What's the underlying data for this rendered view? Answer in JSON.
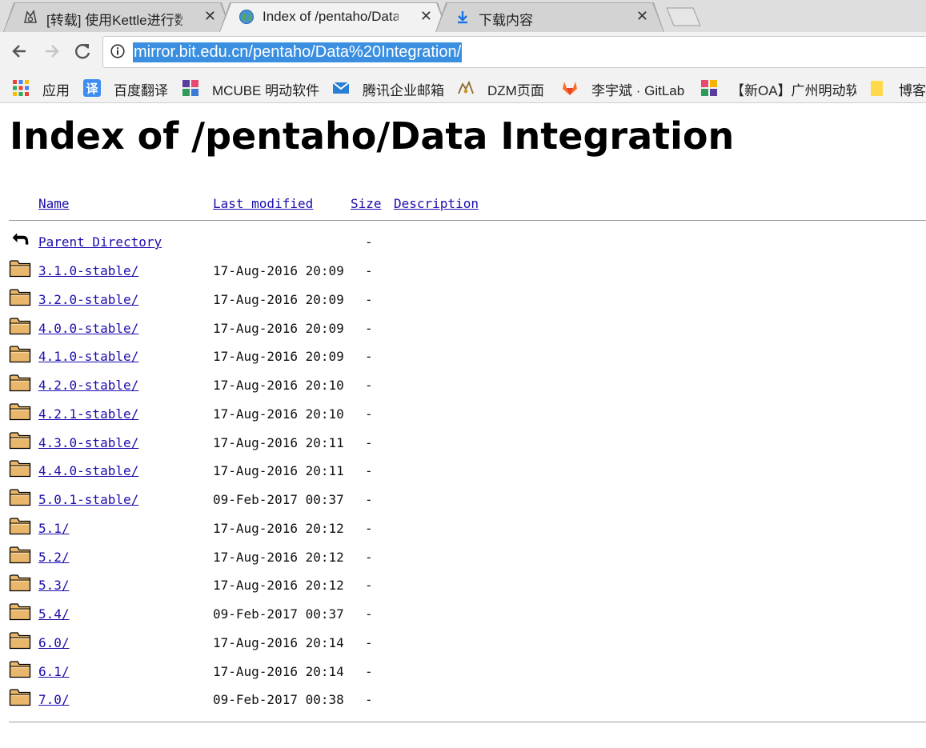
{
  "tabs": [
    {
      "title": "[转载] 使用Kettle进行数据",
      "close": "✕",
      "favicon": "tiger-icon",
      "active": false
    },
    {
      "title": "Index of /pentaho/Data",
      "close": "✕",
      "favicon": "globe-icon",
      "active": true
    },
    {
      "title": "下载内容",
      "close": "✕",
      "favicon": "download-icon",
      "active": false
    }
  ],
  "toolbar": {
    "back": "back-arrow-icon",
    "forward": "forward-arrow-icon",
    "reload": "reload-icon",
    "url": "mirror.bit.edu.cn/pentaho/Data%20Integration/"
  },
  "bookmarks": [
    {
      "label": "应用",
      "icon": "apps-grid-icon"
    },
    {
      "label": "百度翻译",
      "icon": "baidu-translate-icon"
    },
    {
      "label": "MCUBE 明动软件",
      "icon": "mcube-icon"
    },
    {
      "label": "腾讯企业邮箱",
      "icon": "mail-icon"
    },
    {
      "label": "DZM页面",
      "icon": "dzm-icon"
    },
    {
      "label": "李宇斌 · GitLab",
      "icon": "gitlab-icon"
    },
    {
      "label": "【新OA】广州明动软",
      "icon": "oa-icon"
    },
    {
      "label": "博客",
      "icon": "folder-bookmark-icon"
    }
  ],
  "page": {
    "title": "Index of /pentaho/Data Integration",
    "columns": {
      "name": "Name",
      "modified": "Last modified",
      "size": "Size",
      "description": "Description"
    },
    "parent": {
      "name": "Parent Directory",
      "size": "-"
    },
    "entries": [
      {
        "name": "3.1.0-stable/",
        "modified": "17-Aug-2016 20:09",
        "size": "-"
      },
      {
        "name": "3.2.0-stable/",
        "modified": "17-Aug-2016 20:09",
        "size": "-"
      },
      {
        "name": "4.0.0-stable/",
        "modified": "17-Aug-2016 20:09",
        "size": "-"
      },
      {
        "name": "4.1.0-stable/",
        "modified": "17-Aug-2016 20:09",
        "size": "-"
      },
      {
        "name": "4.2.0-stable/",
        "modified": "17-Aug-2016 20:10",
        "size": "-"
      },
      {
        "name": "4.2.1-stable/",
        "modified": "17-Aug-2016 20:10",
        "size": "-"
      },
      {
        "name": "4.3.0-stable/",
        "modified": "17-Aug-2016 20:11",
        "size": "-"
      },
      {
        "name": "4.4.0-stable/",
        "modified": "17-Aug-2016 20:11",
        "size": "-"
      },
      {
        "name": "5.0.1-stable/",
        "modified": "09-Feb-2017 00:37",
        "size": "-"
      },
      {
        "name": "5.1/",
        "modified": "17-Aug-2016 20:12",
        "size": "-"
      },
      {
        "name": "5.2/",
        "modified": "17-Aug-2016 20:12",
        "size": "-"
      },
      {
        "name": "5.3/",
        "modified": "17-Aug-2016 20:12",
        "size": "-"
      },
      {
        "name": "5.4/",
        "modified": "09-Feb-2017 00:37",
        "size": "-"
      },
      {
        "name": "6.0/",
        "modified": "17-Aug-2016 20:14",
        "size": "-"
      },
      {
        "name": "6.1/",
        "modified": "17-Aug-2016 20:14",
        "size": "-"
      },
      {
        "name": "7.0/",
        "modified": "09-Feb-2017 00:38",
        "size": "-"
      }
    ]
  }
}
